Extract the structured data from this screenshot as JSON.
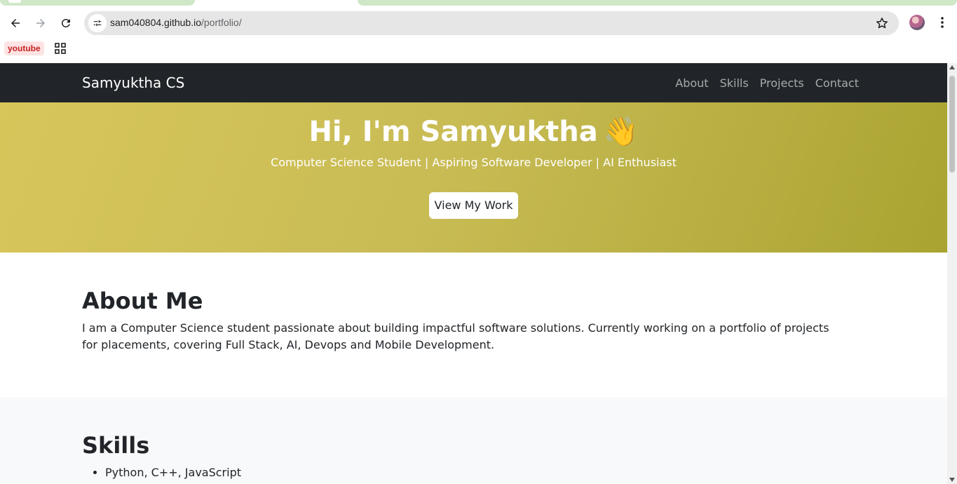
{
  "browser": {
    "url_host": "sam040804.github.io",
    "url_path": "/portfolio/",
    "bookmarks": {
      "youtube_label": "youtube"
    }
  },
  "site": {
    "brand": "Samyuktha CS",
    "nav": [
      "About",
      "Skills",
      "Projects",
      "Contact"
    ]
  },
  "hero": {
    "title": "Hi, I'm Samyuktha",
    "emoji": "👋",
    "subtitle": "Computer Science Student | Aspiring Software Developer | AI Enthusiast",
    "button": "View My Work",
    "gradient_colors": [
      "#d7c65a",
      "#a9a431"
    ]
  },
  "about": {
    "title": "About Me",
    "text": "I am a Computer Science student passionate about building impactful software solutions. Currently working on a portfolio of projects for placements, covering Full Stack, AI, Devops and Mobile Development."
  },
  "skills": {
    "title": "Skills",
    "items": [
      "Python, C++, JavaScript"
    ]
  }
}
